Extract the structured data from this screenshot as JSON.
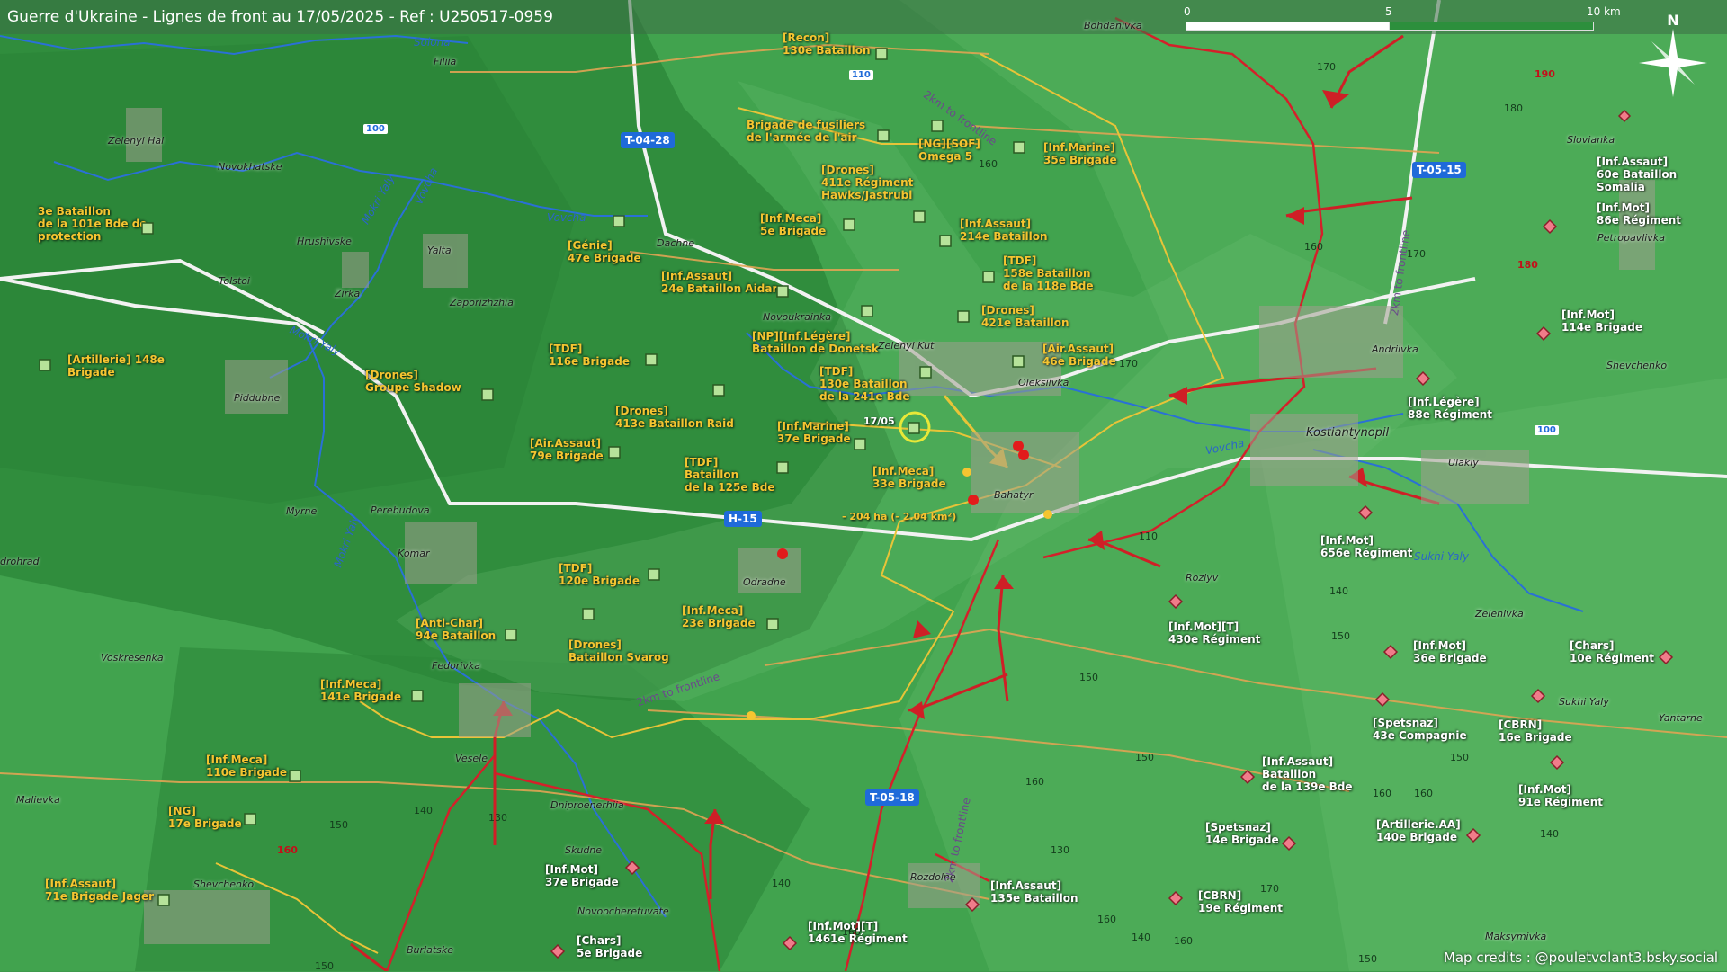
{
  "title": "Guerre d'Ukraine - Lignes de front au 17/05/2025 - Ref : U250517-0959",
  "credits": "Map credits : @pouletvolant3.bsky.social",
  "scale": {
    "labels": [
      "0",
      "5",
      "10 km"
    ]
  },
  "north_label": "N",
  "colors": {
    "ua": "#f5c531",
    "ru": "#e8505a",
    "front": "#d4202a",
    "road_badge": "#1f6ad9"
  },
  "roads": [
    "T-04-28",
    "T-05-15",
    "H-15",
    "T-05-18"
  ],
  "route_numbers": [
    "110",
    "100",
    "100"
  ],
  "rivers": [
    "Solona",
    "Vovcha",
    "Mokri Yaly",
    "Vovcha",
    "Mokri Yaly",
    "Mokri Yaly",
    "Vovcha",
    "Sukhi Yaly"
  ],
  "places": [
    "Filiia",
    "Bohdanivka",
    "Zelenyi Hai",
    "Novokhatske",
    "Hrushivske",
    "Yalta",
    "Tolstoi",
    "Zirka",
    "Zaporizhzhia",
    "Dachne",
    "Novoukrainka",
    "Zelenyi Kut",
    "Oleksiivka",
    "Bahatyr",
    "Andriivka",
    "Kostiantynopil",
    "Ulakly",
    "Slovianka",
    "Petropavlivka",
    "Shevchenko",
    "Piddubne",
    "Myrne",
    "Perebudova",
    "Komar",
    "Odradne",
    "Voskresenka",
    "Fedorivka",
    "Vesele",
    "Malievka",
    "Dniproenerhiia",
    "Skudne",
    "Novoocheretuvate",
    "Shevchenko",
    "Burlatske",
    "Rozdolne",
    "Rozlyv",
    "Zelenivka",
    "Sukhi Yaly",
    "Yantarne",
    "Maksymivka",
    "drohrad"
  ],
  "elevations": [
    "170",
    "180",
    "170",
    "160",
    "160",
    "170",
    "110",
    "140",
    "150",
    "150",
    "150",
    "160",
    "150",
    "160",
    "160",
    "140",
    "130",
    "140",
    "150",
    "140",
    "130",
    "150",
    "160",
    "170",
    "160",
    "140",
    "150",
    "160"
  ],
  "elevations_red": [
    "190",
    "180",
    "160"
  ],
  "frontline_labels": [
    "2km to frontline",
    "2km to frontline",
    "2km to frontline",
    "2km to frontline"
  ],
  "annotations": {
    "date": "17/05",
    "area": "- 204 ha (- 2.04 km²)"
  },
  "ua_units": [
    "[Recon]\n130e Bataillon",
    "Brigade de fusiliers\nde l'armée de l'air",
    "[NG][SOF]\nOmega 5",
    "[Inf.Marine]\n35e Brigade",
    "[Drones]\n411e Régiment\nHawks/Jastrubi",
    "[Inf.Meca]\n5e Brigade",
    "[Inf.Assaut]\n214e Bataillon",
    "3e Bataillon\nde la 101e Bde de\nprotection",
    "[Génie]\n47e Brigade",
    "[Inf.Assaut]\n24e Bataillon Aidar",
    "[TDF]\n158e Bataillon\nde la 118e Bde",
    "[Drones]\n421e Bataillon",
    "[NP][Inf.Légère]\nBataillon de Donetsk",
    "[Artillerie] 148e\nBrigade",
    "[TDF]\n116e Brigade",
    "[Air.Assaut]\n46e Brigade",
    "[TDF]\n130e Bataillon\nde la 241e Bde",
    "[Drones]\nGroupe Shadow",
    "[Drones]\n413e Bataillon Raid",
    "[Inf.Marine]\n37e Brigade",
    "[Air.Assaut]\n79e Brigade",
    "[TDF]\nBataillon\nde la 125e Bde",
    "[Inf.Meca]\n33e Brigade",
    "[TDF]\n120e Brigade",
    "[Inf.Meca]\n23e Brigade",
    "[Anti-Char]\n94e Bataillon",
    "[Drones]\nBataillon Svarog",
    "[Inf.Meca]\n141e Brigade",
    "[Inf.Meca]\n110e Brigade",
    "[NG]\n17e Brigade",
    "[Inf.Assaut]\n71e Brigade Jager"
  ],
  "ru_units": [
    "[Inf.Assaut]\n60e Bataillon\nSomalia",
    "[Inf.Mot]\n86e Régiment",
    "[Inf.Mot]\n114e Brigade",
    "[Inf.Légère]\n88e Régiment",
    "[Inf.Mot]\n656e Régiment",
    "[Inf.Mot][T]\n430e Régiment",
    "[Inf.Mot]\n36e Brigade",
    "[Chars]\n10e Régiment",
    "[Spetsnaz]\n43e Compagnie",
    "[CBRN]\n16e Brigade",
    "[Inf.Assaut]\nBataillon\nde la 139e Bde",
    "[Inf.Mot]\n91e Régiment",
    "[Spetsnaz]\n14e Brigade",
    "[Artillerie.AA]\n140e Brigade",
    "[Inf.Mot]\n37e Brigade",
    "[Inf.Assaut]\n135e Bataillon",
    "[CBRN]\n19e Régiment",
    "[Chars]\n5e Brigade",
    "[Inf.Mot][T]\n1461e Régiment"
  ]
}
